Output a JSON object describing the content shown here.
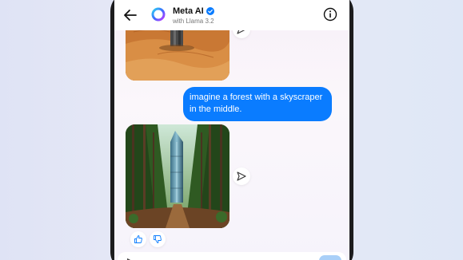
{
  "header": {
    "title": "Meta AI",
    "subtitle": "with Llama 3.2",
    "verified": true
  },
  "messages": [
    {
      "type": "image",
      "from": "ai",
      "description": "desert-skyscraper"
    },
    {
      "type": "text",
      "from": "user",
      "text": "imagine a forest with a skyscraper in the middle."
    },
    {
      "type": "image",
      "from": "ai",
      "description": "forest-skyscraper"
    }
  ],
  "icons": {
    "back": "back-arrow-icon",
    "info": "info-icon",
    "share": "send-icon",
    "like": "thumbs-up-icon",
    "dislike": "thumbs-down-icon"
  },
  "colors": {
    "user_bubble": "#0a7cff",
    "accent": "#0a7cff",
    "send_disabled": "#a9cff8"
  }
}
